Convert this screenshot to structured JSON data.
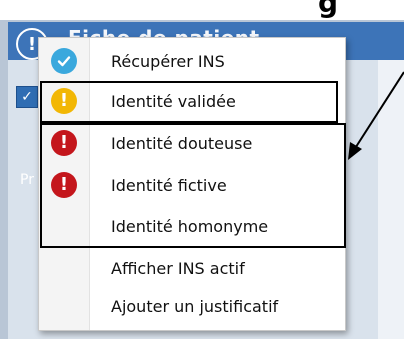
{
  "background": {
    "title_partial": "g",
    "window_title": "Fiche de patient",
    "side_label": "Pr",
    "colors": {
      "header": "#3d74b8",
      "content": "#d9e2ec"
    }
  },
  "context_menu": {
    "items": [
      {
        "label": "Récupérer INS",
        "icon": "check-badge-icon",
        "color": "#3aa8dd"
      },
      {
        "label": "Identité validée",
        "icon": "warning-exclamation-icon",
        "color": "#f2b705"
      },
      {
        "label": "Identité douteuse",
        "icon": "error-exclamation-icon",
        "color": "#c4161c"
      },
      {
        "label": "Identité fictive",
        "icon": "error-exclamation-icon",
        "color": "#c4161c"
      },
      {
        "label": "Identité homonyme",
        "icon": "",
        "color": ""
      },
      {
        "label": "Afficher INS actif",
        "icon": "",
        "color": ""
      },
      {
        "label": "Ajouter un justificatif",
        "icon": "",
        "color": ""
      }
    ]
  }
}
